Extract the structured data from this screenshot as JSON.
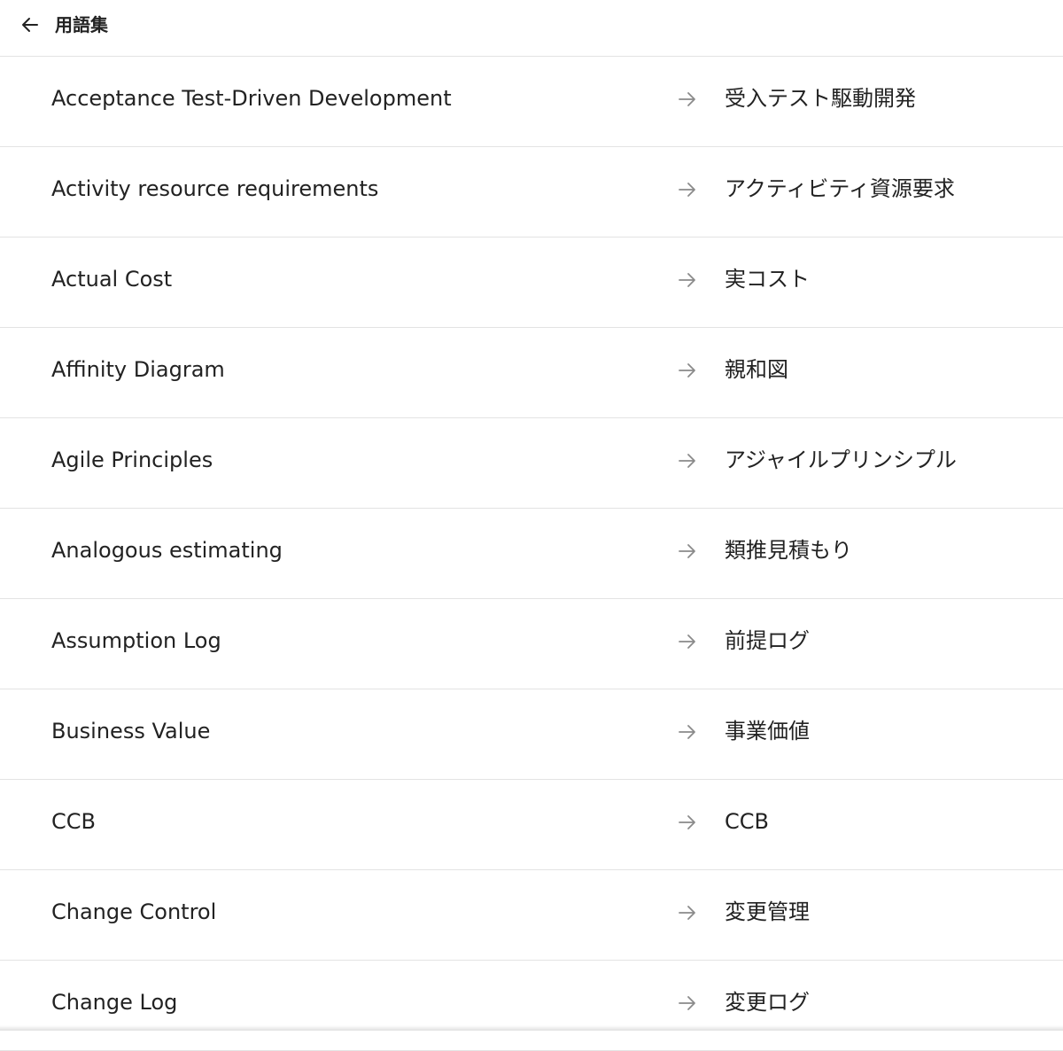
{
  "header": {
    "title": "用語集",
    "back_icon": "arrow-left-icon"
  },
  "terms": [
    {
      "en": "Acceptance Test-Driven Development",
      "ja": "受入テスト駆動開発"
    },
    {
      "en": "Activity resource requirements",
      "ja": "アクティビティ資源要求"
    },
    {
      "en": "Actual Cost",
      "ja": "実コスト"
    },
    {
      "en": "Affinity Diagram",
      "ja": "親和図"
    },
    {
      "en": "Agile Principles",
      "ja": "アジャイルプリンシプル"
    },
    {
      "en": "Analogous estimating",
      "ja": "類推見積もり"
    },
    {
      "en": "Assumption Log",
      "ja": "前提ログ"
    },
    {
      "en": "Business Value",
      "ja": "事業価値"
    },
    {
      "en": "CCB",
      "ja": "CCB"
    },
    {
      "en": "Change Control",
      "ja": "変更管理"
    },
    {
      "en": "Change Log",
      "ja": "変更ログ"
    }
  ],
  "colors": {
    "text": "#222222",
    "divider": "#e3e3e3",
    "arrow": "#8a8a8a"
  }
}
